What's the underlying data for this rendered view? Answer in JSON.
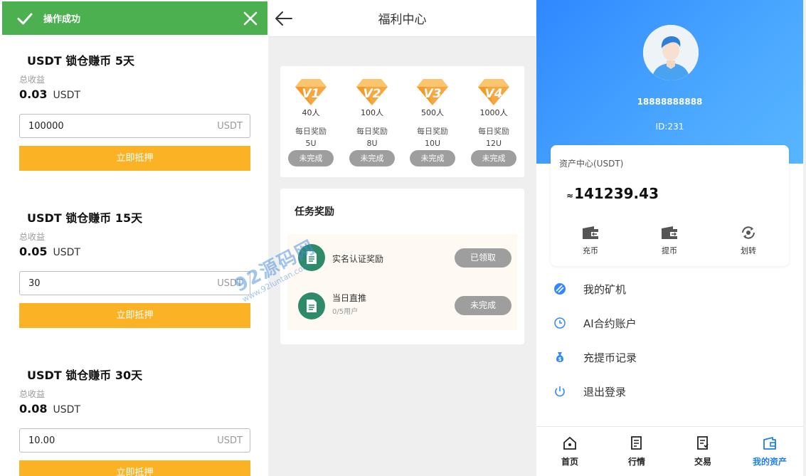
{
  "toast": {
    "message": "操作成功",
    "icon": "check-icon",
    "close_icon": "close-icon"
  },
  "staking": {
    "products": [
      {
        "title": "USDT 锁仓赚币 5天",
        "earn_label": "总收益",
        "earn_value": "0.03",
        "earn_unit": "USDT",
        "amount": "100000",
        "amount_unit": "USDT",
        "button": "立即抵押"
      },
      {
        "title": "USDT 锁仓赚币 15天",
        "earn_label": "总收益",
        "earn_value": "0.05",
        "earn_unit": "USDT",
        "amount": "30",
        "amount_unit": "USDT",
        "button": "立即抵押"
      },
      {
        "title": "USDT 锁仓赚币 30天",
        "earn_label": "总收益",
        "earn_value": "0.08",
        "earn_unit": "USDT",
        "amount": "10.00",
        "amount_unit": "USDT",
        "button": "立即抵押"
      }
    ]
  },
  "welfare": {
    "title": "福利中心",
    "levels": [
      {
        "badge": "V1",
        "count": "40人",
        "daily_label": "每日奖励",
        "reward": "5U",
        "status": "未完成"
      },
      {
        "badge": "V2",
        "count": "100人",
        "daily_label": "每日奖励",
        "reward": "8U",
        "status": "未完成"
      },
      {
        "badge": "V3",
        "count": "500人",
        "daily_label": "每日奖励",
        "reward": "10U",
        "status": "未完成"
      },
      {
        "badge": "V4",
        "count": "1000人",
        "daily_label": "每日奖励",
        "reward": "12U",
        "status": "未完成"
      }
    ],
    "task_title": "任务奖励",
    "tasks": [
      {
        "name": "实名认证奖励",
        "sub": "",
        "status": "已领取"
      },
      {
        "name": "当日直推",
        "sub": "0/5用户",
        "status": "未完成"
      }
    ]
  },
  "watermark": {
    "big": "92源码网",
    "small": "www.92luntan.com"
  },
  "account": {
    "phone": "18888888888",
    "uid": "ID:231",
    "asset_title": "资产中心(USDT)",
    "balance_prefix": "≈",
    "balance": "141239.43",
    "actions": [
      {
        "label": "充币",
        "icon": "wallet-in-icon"
      },
      {
        "label": "提币",
        "icon": "wallet-out-icon"
      },
      {
        "label": "划转",
        "icon": "transfer-icon"
      }
    ],
    "menu": [
      {
        "label": "我的矿机",
        "icon": "miner-icon"
      },
      {
        "label": "AI合约账户",
        "icon": "clock-icon"
      },
      {
        "label": "充提币记录",
        "icon": "money-bag-icon"
      },
      {
        "label": "退出登录",
        "icon": "power-icon"
      }
    ],
    "tabs": [
      {
        "label": "首页",
        "icon": "home-icon"
      },
      {
        "label": "行情",
        "icon": "market-icon"
      },
      {
        "label": "交易",
        "icon": "trade-icon"
      },
      {
        "label": "我的资产",
        "icon": "wallet-icon"
      }
    ],
    "accent": "#1f7fe8"
  },
  "colors": {
    "toast": "#4caf50",
    "stake_button": "#fbb325",
    "status_gray": "#9e9e9e",
    "task_icon": "#2e8b6a",
    "banner": "#3a98ff"
  }
}
